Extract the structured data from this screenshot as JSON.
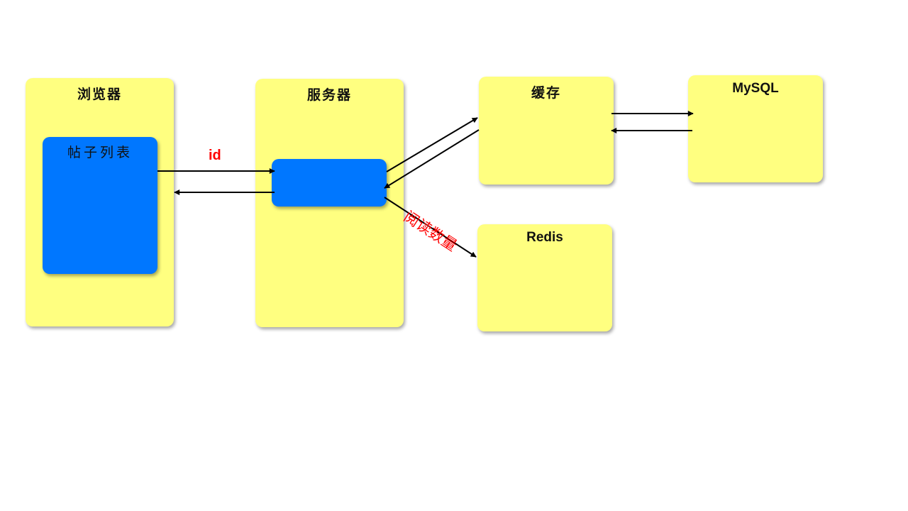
{
  "nodes": {
    "browser": {
      "label": "浏览器"
    },
    "post_list": {
      "label": "帖子列表"
    },
    "server": {
      "label": "服务器"
    },
    "cache": {
      "label": "缓存"
    },
    "mysql": {
      "label": "MySQL"
    },
    "redis": {
      "label": "Redis"
    }
  },
  "edges": {
    "id_label": "id",
    "read_count_label": "阅读数量"
  },
  "colors": {
    "container": "#ffff80",
    "inner": "#0077ff",
    "label": "#ff0000"
  }
}
